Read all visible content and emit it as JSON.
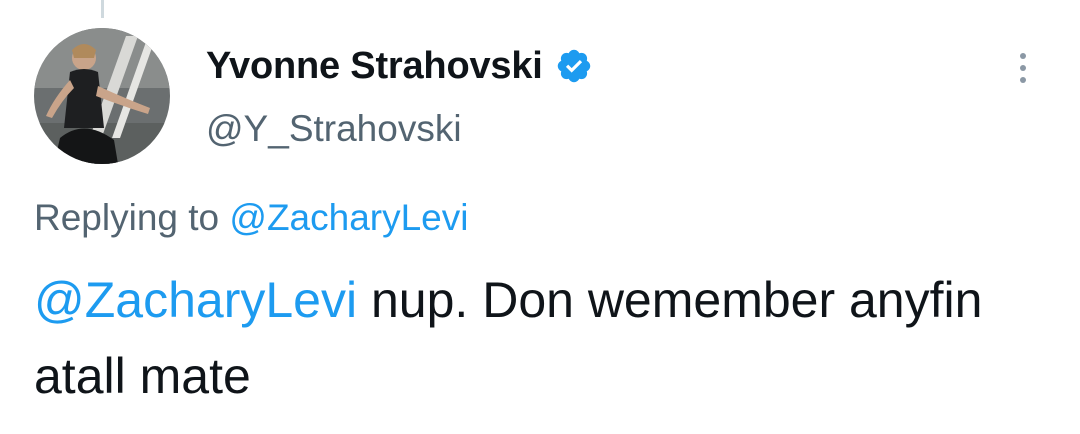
{
  "tweet": {
    "author": {
      "display_name": "Yvonne Strahovski",
      "handle": "@Y_Strahovski",
      "verified": true,
      "avatar_icon": "profile-photo"
    },
    "replying_to": {
      "prefix": "Replying to",
      "mention": "@ZacharyLevi"
    },
    "body": {
      "mention": "@ZacharyLevi",
      "text": " nup. Don wemember anyfin atall mate"
    },
    "menu_icon": "more-vertical-icon"
  },
  "colors": {
    "link": "#1d9bf0",
    "secondary_text": "#536471",
    "primary_text": "#0f1419",
    "verified_badge": "#1d9bf0"
  }
}
